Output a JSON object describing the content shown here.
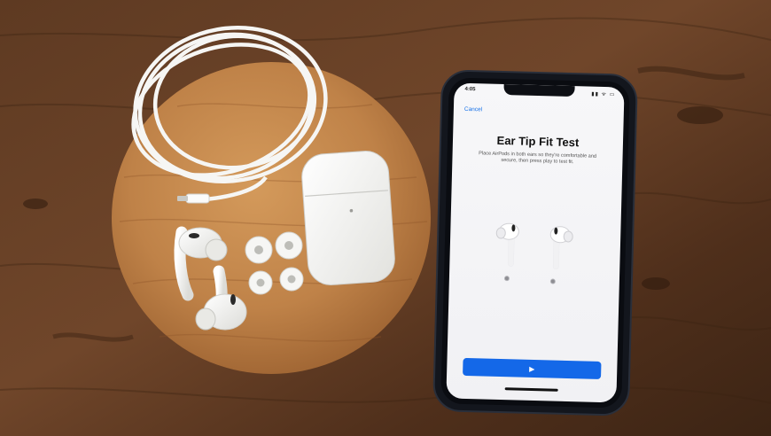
{
  "phone": {
    "status_time": "4:05",
    "status_icons": "▮▮ ᯤ ▭",
    "cancel_label": "Cancel",
    "title": "Ear Tip Fit Test",
    "description": "Place AirPods in both ears so they're comfortable and secure, then press play to test fit.",
    "play_icon": "play-icon",
    "play_glyph": "▶"
  },
  "colors": {
    "wood_table": "#5a3620",
    "wood_board": "#c4894d",
    "phone_case": "#13161d",
    "accent_blue": "#1468e8",
    "airpods_white": "#f4f4f2"
  }
}
